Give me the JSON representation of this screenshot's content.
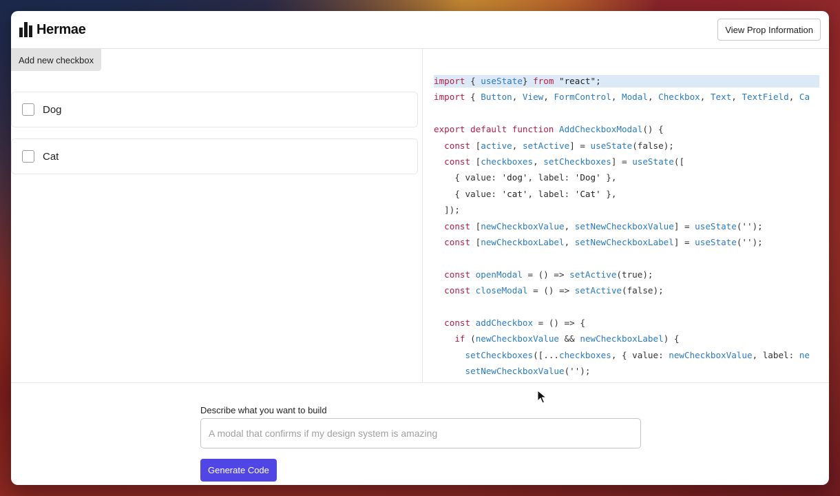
{
  "app": {
    "brand": "Hermae"
  },
  "header": {
    "view_prop_label": "View Prop Information"
  },
  "preview": {
    "add_button_label": "Add new checkbox",
    "checkboxes": [
      {
        "label": "Dog"
      },
      {
        "label": "Cat"
      }
    ]
  },
  "code": {
    "lines": [
      [
        [
          "kw",
          "import"
        ],
        [
          "",
          "{ "
        ],
        [
          "fn",
          "useState"
        ],
        [
          "",
          ""
        ],
        [
          "",
          "} "
        ],
        [
          "kw",
          "from"
        ],
        [
          "str",
          " \"react\";"
        ]
      ],
      [
        [
          "kw",
          "import"
        ],
        [
          "",
          "{ "
        ],
        [
          "fn",
          "Button"
        ],
        [
          "",
          ", "
        ],
        [
          "fn",
          "View"
        ],
        [
          "",
          ", "
        ],
        [
          "fn",
          "FormControl"
        ],
        [
          "",
          ", "
        ],
        [
          "fn",
          "Modal"
        ],
        [
          "",
          ", "
        ],
        [
          "fn",
          "Checkbox"
        ],
        [
          "",
          ", "
        ],
        [
          "fn",
          "Text"
        ],
        [
          "",
          ", "
        ],
        [
          "fn",
          "TextField"
        ],
        [
          "",
          ", "
        ],
        [
          "fn",
          "Ca"
        ]
      ],
      [],
      [
        [
          "kw",
          "export default function"
        ],
        [
          "",
          ""
        ],
        [
          "fn",
          "AddCheckboxModal"
        ],
        [
          "",
          "() {"
        ]
      ],
      [
        [
          "",
          "  "
        ],
        [
          "kw",
          "const"
        ],
        [
          "",
          ""
        ],
        [
          "",
          "["
        ],
        [
          "fn",
          "active"
        ],
        [
          "",
          ", "
        ],
        [
          "fn",
          "setActive"
        ],
        [
          "",
          "] = "
        ],
        [
          "fn",
          "useState"
        ],
        [
          "",
          "(false);"
        ]
      ],
      [
        [
          "",
          "  "
        ],
        [
          "kw",
          "const"
        ],
        [
          "",
          ""
        ],
        [
          "",
          "["
        ],
        [
          "fn",
          "checkboxes"
        ],
        [
          "",
          ", "
        ],
        [
          "fn",
          "setCheckboxes"
        ],
        [
          "",
          "] = "
        ],
        [
          "fn",
          "useState"
        ],
        [
          "",
          "(["
        ]
      ],
      [
        [
          "",
          "    { value: "
        ],
        [
          "str",
          "'dog'"
        ],
        [
          "",
          ", label: "
        ],
        [
          "str",
          "'Dog'"
        ],
        [
          "",
          " },"
        ]
      ],
      [
        [
          "",
          "    { value: "
        ],
        [
          "str",
          "'cat'"
        ],
        [
          "",
          ", label: "
        ],
        [
          "str",
          "'Cat'"
        ],
        [
          "",
          " },"
        ]
      ],
      [
        [
          "",
          "  ]);"
        ]
      ],
      [
        [
          "",
          "  "
        ],
        [
          "kw",
          "const"
        ],
        [
          "",
          ""
        ],
        [
          "",
          "["
        ],
        [
          "fn",
          "newCheckboxValue"
        ],
        [
          "",
          ", "
        ],
        [
          "fn",
          "setNewCheckboxValue"
        ],
        [
          "",
          "] = "
        ],
        [
          "fn",
          "useState"
        ],
        [
          "",
          "('');"
        ]
      ],
      [
        [
          "",
          "  "
        ],
        [
          "kw",
          "const"
        ],
        [
          "",
          ""
        ],
        [
          "",
          "["
        ],
        [
          "fn",
          "newCheckboxLabel"
        ],
        [
          "",
          ", "
        ],
        [
          "fn",
          "setNewCheckboxLabel"
        ],
        [
          "",
          "] = "
        ],
        [
          "fn",
          "useState"
        ],
        [
          "",
          "('');"
        ]
      ],
      [],
      [
        [
          "",
          "  "
        ],
        [
          "kw",
          "const"
        ],
        [
          "",
          ""
        ],
        [
          "fn",
          "openModal"
        ],
        [
          "",
          " = () => "
        ],
        [
          "fn",
          "setActive"
        ],
        [
          "",
          "(true);"
        ]
      ],
      [
        [
          "",
          "  "
        ],
        [
          "kw",
          "const"
        ],
        [
          "",
          ""
        ],
        [
          "fn",
          "closeModal"
        ],
        [
          "",
          " = () => "
        ],
        [
          "fn",
          "setActive"
        ],
        [
          "",
          "(false);"
        ]
      ],
      [],
      [
        [
          "",
          "  "
        ],
        [
          "kw",
          "const"
        ],
        [
          "",
          ""
        ],
        [
          "fn",
          "addCheckbox"
        ],
        [
          "",
          " = () => {"
        ]
      ],
      [
        [
          "",
          "    "
        ],
        [
          "kw",
          "if"
        ],
        [
          "",
          " ("
        ],
        [
          "fn",
          "newCheckboxValue"
        ],
        [
          "",
          " && "
        ],
        [
          "fn",
          "newCheckboxLabel"
        ],
        [
          "",
          ") {"
        ]
      ],
      [
        [
          "",
          "      "
        ],
        [
          "fn",
          "setCheckboxes"
        ],
        [
          "",
          "([..."
        ],
        [
          "fn",
          "checkboxes"
        ],
        [
          "",
          ", { value: "
        ],
        [
          "fn",
          "newCheckboxValue"
        ],
        [
          "",
          ", label: "
        ],
        [
          "fn",
          "ne"
        ]
      ],
      [
        [
          "",
          "      "
        ],
        [
          "fn",
          "setNewCheckboxValue"
        ],
        [
          "",
          "('');"
        ]
      ]
    ]
  },
  "builder": {
    "prompt_label": "Describe what you want to build",
    "prompt_placeholder": "A modal that confirms if my design system is amazing",
    "generate_label": "Generate Code"
  }
}
